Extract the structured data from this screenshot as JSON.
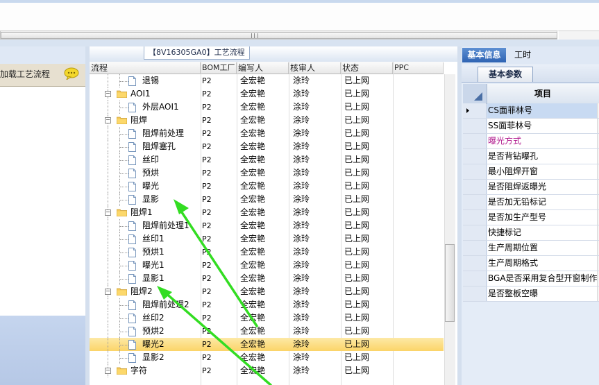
{
  "center_panel": {
    "title": "【8V16305GA0】工艺流程",
    "columns": [
      "流程",
      "BOM工厂",
      "编写人",
      "核审人",
      "状态",
      "PPC"
    ]
  },
  "left_panel": {
    "load_label": "加载工艺流程",
    "icon": "chat-bubble-icon"
  },
  "right_panel": {
    "tabs": [
      {
        "label": "基本信息",
        "active": true
      },
      {
        "label": "工时",
        "active": false
      }
    ],
    "subtab": "基本参数",
    "column": "项目",
    "items": [
      {
        "label": "CS面菲林号",
        "selected": true,
        "color": "#000000"
      },
      {
        "label": "SS面菲林号",
        "selected": false,
        "color": "#000000"
      },
      {
        "label": "曝光方式",
        "selected": false,
        "color": "#b0198e"
      },
      {
        "label": "是否背钻曝孔",
        "selected": false,
        "color": "#000000"
      },
      {
        "label": "最小阻焊开窗",
        "selected": false,
        "color": "#000000"
      },
      {
        "label": "是否阻焊返曝光",
        "selected": false,
        "color": "#000000"
      },
      {
        "label": "是否加无铅标记",
        "selected": false,
        "color": "#000000"
      },
      {
        "label": "是否加生产型号",
        "selected": false,
        "color": "#000000"
      },
      {
        "label": "快捷标记",
        "selected": false,
        "color": "#000000"
      },
      {
        "label": "生产周期位置",
        "selected": false,
        "color": "#000000"
      },
      {
        "label": "生产周期格式",
        "selected": false,
        "color": "#000000"
      },
      {
        "label": "BGA是否采用复合型开窗制作",
        "selected": false,
        "color": "#000000"
      },
      {
        "label": "是否整板空曝",
        "selected": false,
        "color": "#000000"
      }
    ]
  },
  "process_rows": [
    {
      "name": "退锡",
      "level": "child",
      "bom": "P2",
      "writer": "全宏艳",
      "reviewer": "涂玲",
      "status": "已上网"
    },
    {
      "name": "AOI1",
      "level": "group",
      "bom": "P2",
      "writer": "全宏艳",
      "reviewer": "涂玲",
      "status": "已上网"
    },
    {
      "name": "外层AOI1",
      "level": "child",
      "bom": "P2",
      "writer": "全宏艳",
      "reviewer": "涂玲",
      "status": "已上网"
    },
    {
      "name": "阻焊",
      "level": "group",
      "bom": "P2",
      "writer": "全宏艳",
      "reviewer": "涂玲",
      "status": "已上网"
    },
    {
      "name": "阻焊前处理",
      "level": "child",
      "bom": "P2",
      "writer": "全宏艳",
      "reviewer": "涂玲",
      "status": "已上网"
    },
    {
      "name": "阻焊塞孔",
      "level": "child",
      "bom": "P2",
      "writer": "全宏艳",
      "reviewer": "涂玲",
      "status": "已上网"
    },
    {
      "name": "丝印",
      "level": "child",
      "bom": "P2",
      "writer": "全宏艳",
      "reviewer": "涂玲",
      "status": "已上网"
    },
    {
      "name": "预烘",
      "level": "child",
      "bom": "P2",
      "writer": "全宏艳",
      "reviewer": "涂玲",
      "status": "已上网"
    },
    {
      "name": "曝光",
      "level": "child",
      "bom": "P2",
      "writer": "全宏艳",
      "reviewer": "涂玲",
      "status": "已上网"
    },
    {
      "name": "显影",
      "level": "child",
      "bom": "P2",
      "writer": "全宏艳",
      "reviewer": "涂玲",
      "status": "已上网"
    },
    {
      "name": "阻焊1",
      "level": "group",
      "bom": "P2",
      "writer": "全宏艳",
      "reviewer": "涂玲",
      "status": "已上网"
    },
    {
      "name": "阻焊前处理1",
      "level": "child",
      "bom": "P2",
      "writer": "全宏艳",
      "reviewer": "涂玲",
      "status": "已上网"
    },
    {
      "name": "丝印1",
      "level": "child",
      "bom": "P2",
      "writer": "全宏艳",
      "reviewer": "涂玲",
      "status": "已上网"
    },
    {
      "name": "预烘1",
      "level": "child",
      "bom": "P2",
      "writer": "全宏艳",
      "reviewer": "涂玲",
      "status": "已上网"
    },
    {
      "name": "曝光1",
      "level": "child",
      "bom": "P2",
      "writer": "全宏艳",
      "reviewer": "涂玲",
      "status": "已上网"
    },
    {
      "name": "显影1",
      "level": "child",
      "bom": "P2",
      "writer": "全宏艳",
      "reviewer": "涂玲",
      "status": "已上网"
    },
    {
      "name": "阻焊2",
      "level": "group",
      "bom": "P2",
      "writer": "全宏艳",
      "reviewer": "涂玲",
      "status": "已上网"
    },
    {
      "name": "阻焊前处理2",
      "level": "child",
      "bom": "P2",
      "writer": "全宏艳",
      "reviewer": "涂玲",
      "status": "已上网"
    },
    {
      "name": "丝印2",
      "level": "child",
      "bom": "P2",
      "writer": "全宏艳",
      "reviewer": "涂玲",
      "status": "已上网"
    },
    {
      "name": "预烘2",
      "level": "child",
      "bom": "P2",
      "writer": "全宏艳",
      "reviewer": "涂玲",
      "status": "已上网"
    },
    {
      "name": "曝光2",
      "level": "child",
      "bom": "P2",
      "writer": "全宏艳",
      "reviewer": "涂玲",
      "status": "已上网",
      "selected": true
    },
    {
      "name": "显影2",
      "level": "child",
      "bom": "P2",
      "writer": "全宏艳",
      "reviewer": "涂玲",
      "status": "已上网"
    },
    {
      "name": "字符",
      "level": "group",
      "bom": "P2",
      "writer": "全宏艳",
      "reviewer": "涂玲",
      "status": "已上网"
    }
  ],
  "colors": {
    "selection": "#fbd468",
    "annotation_arrow": "#33dd22",
    "tab_active": "#2e63b3"
  }
}
